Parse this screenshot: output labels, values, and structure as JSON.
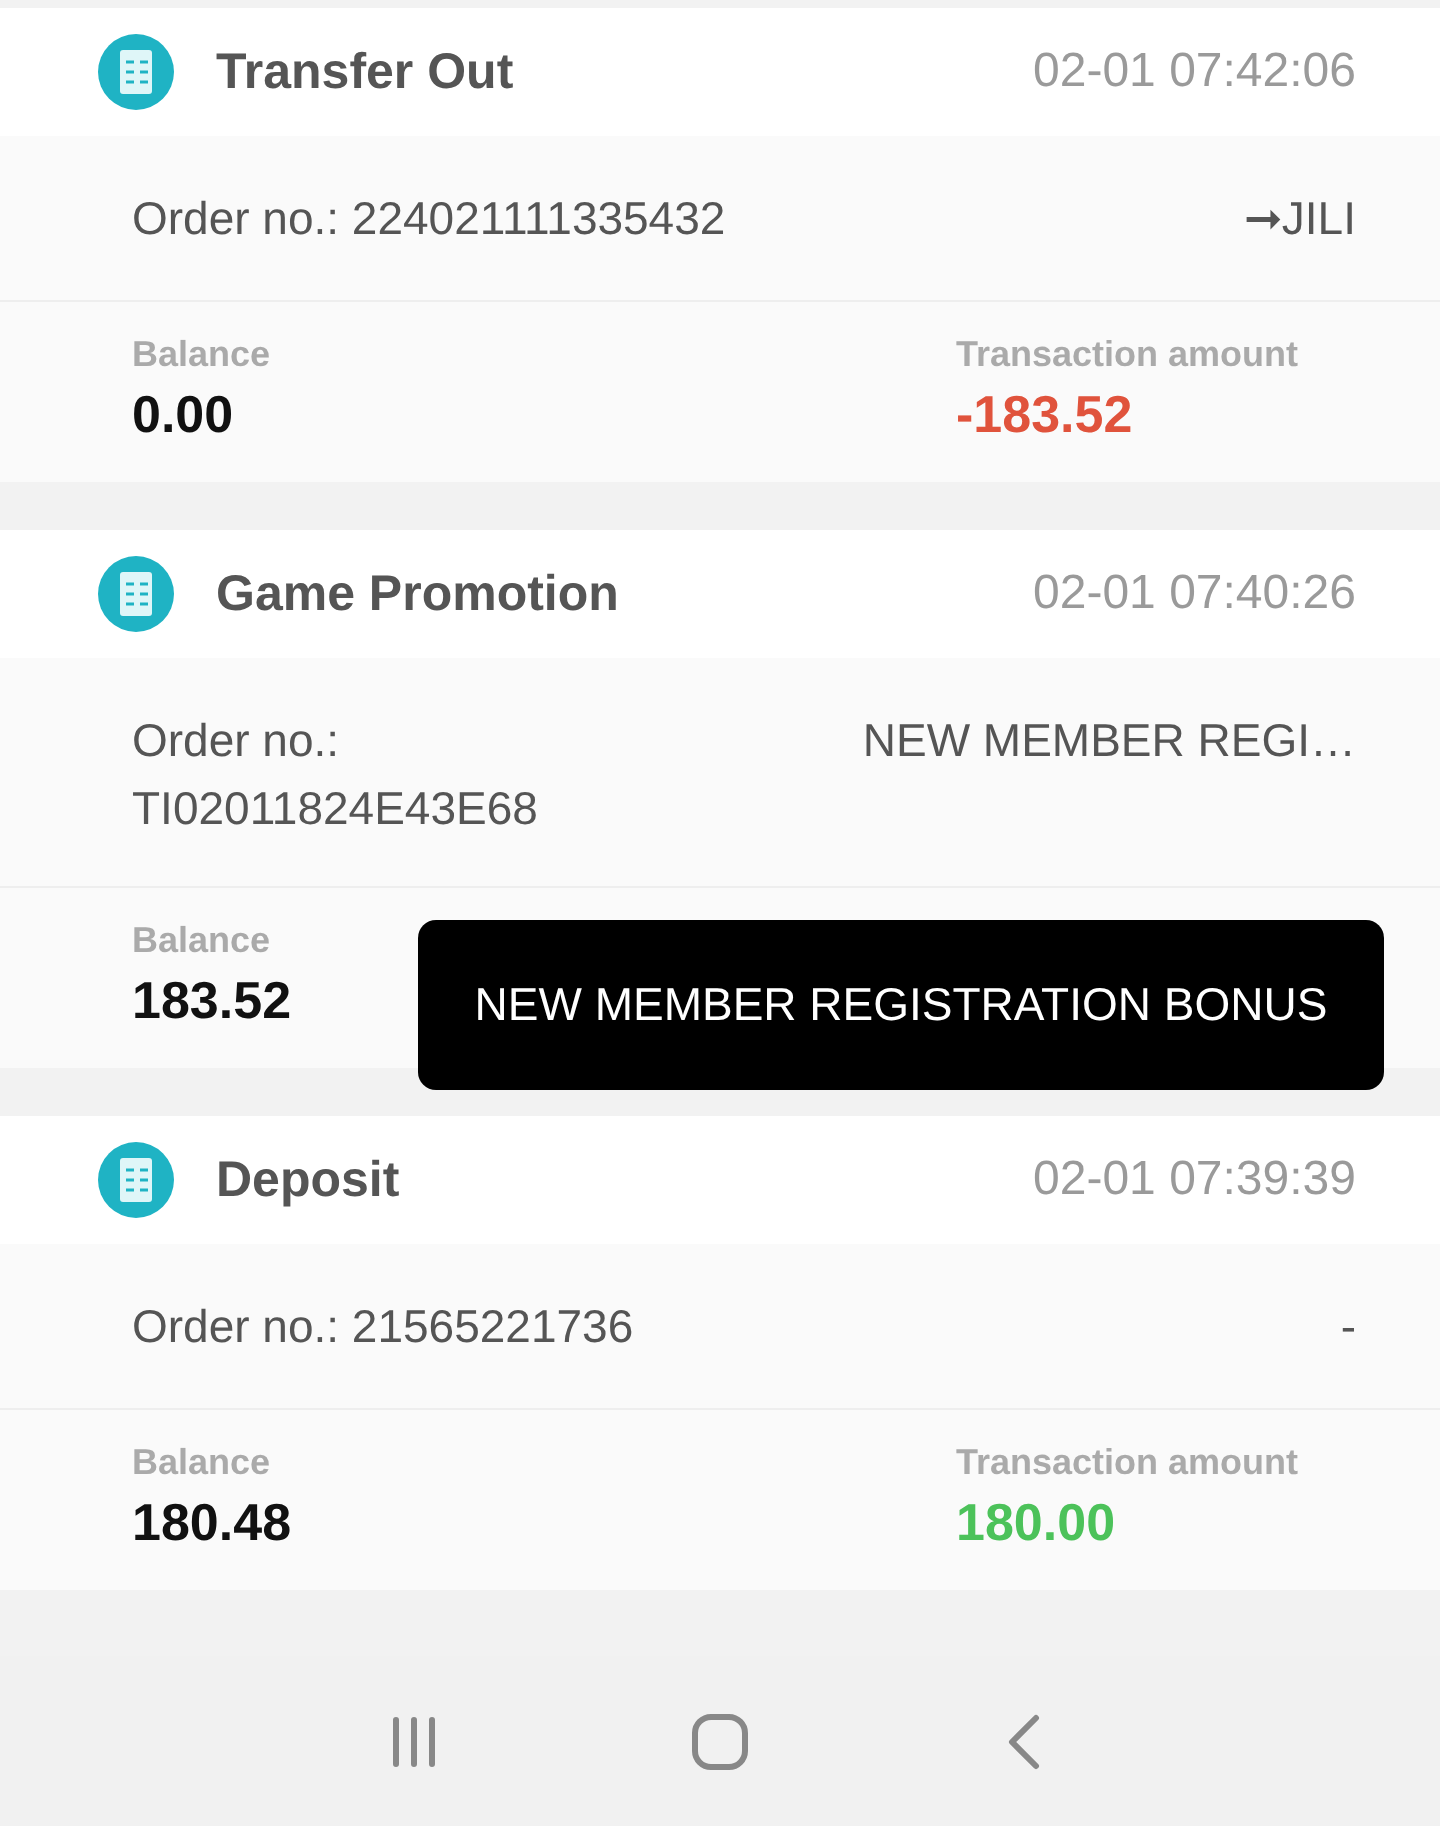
{
  "transactions": [
    {
      "title": "Transfer Out",
      "time": "02-01 07:42:06",
      "order": "Order no.: 224021111335432",
      "detail": "➞JILI",
      "balance_label": "Balance",
      "balance": "0.00",
      "amount_label": "Transaction amount",
      "amount": "-183.52",
      "color": "#e0533c"
    },
    {
      "title": "Game Promotion",
      "time": "02-01 07:40:26",
      "order": "Order no.: TI02011824E43E68",
      "detail": "NEW MEMBER REGI…",
      "balance_label": "Balance",
      "balance": "183.52"
    },
    {
      "title": "Deposit",
      "time": "02-01 07:39:39",
      "order": "Order no.: 21565221736",
      "detail": "-",
      "balance_label": "Balance",
      "balance": "180.48",
      "amount_label": "Transaction amount",
      "amount": "180.00",
      "color": "#4cc25a"
    }
  ],
  "tooltip": "NEW MEMBER REGISTRATION BONUS"
}
